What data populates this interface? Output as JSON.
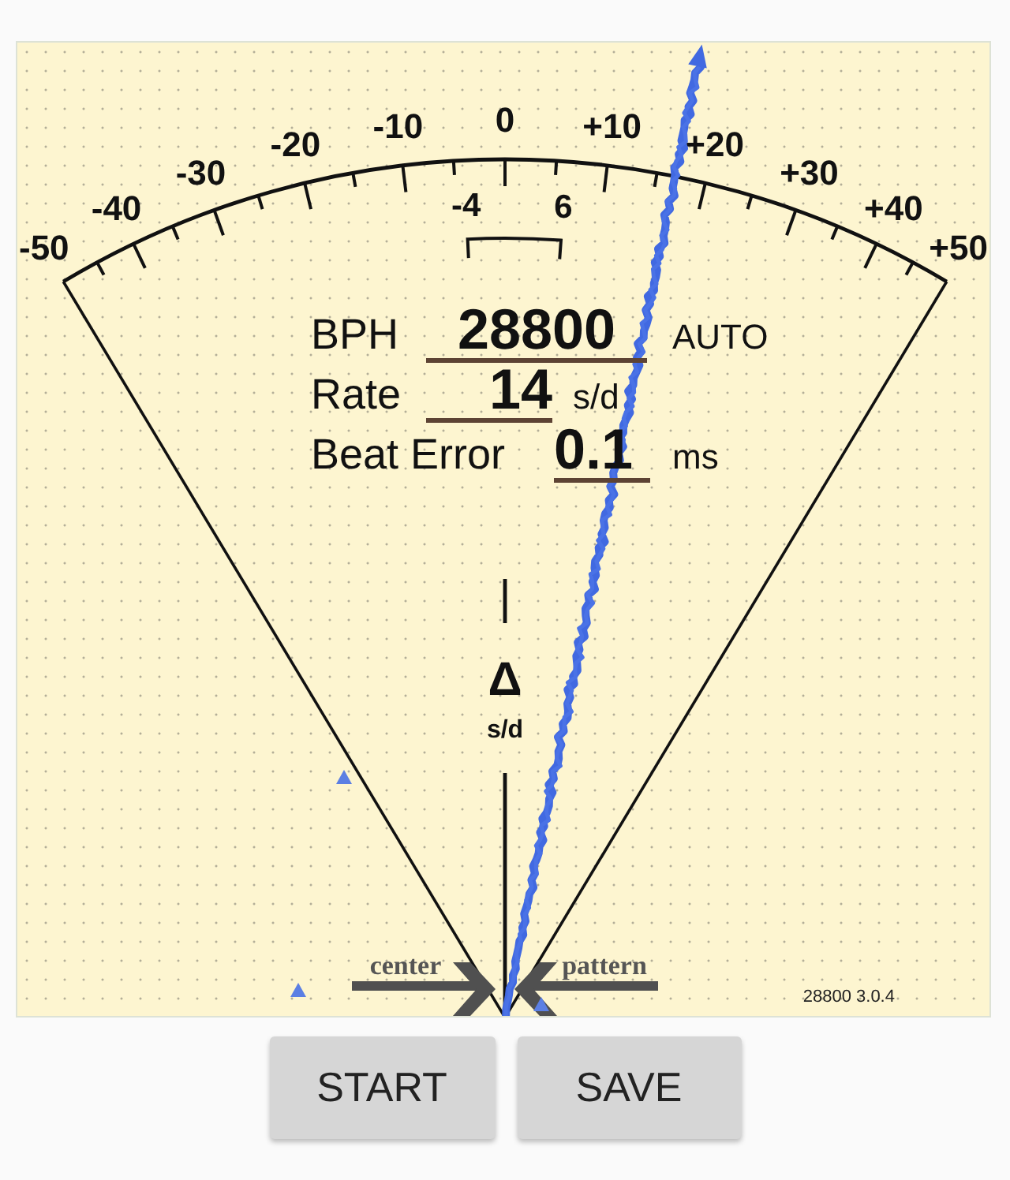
{
  "dial": {
    "scale_labels": [
      "-50",
      "-40",
      "-30",
      "-20",
      "-10",
      "0",
      "+10",
      "+20",
      "+30",
      "+40",
      "+50"
    ],
    "tolerance_labels": [
      "-4",
      "6"
    ],
    "axis": {
      "symbol": "Δ",
      "unit": "s/d"
    },
    "pointers": [
      {
        "label": "center"
      },
      {
        "label": "pattern"
      }
    ],
    "version": "28800 3.0.4"
  },
  "readings": [
    {
      "label": "BPH",
      "value": "28800",
      "suffix": "AUTO"
    },
    {
      "label": "Rate",
      "value": "14",
      "suffix": "s/d"
    },
    {
      "label": "Beat Error",
      "value": "0.1",
      "suffix": "ms"
    }
  ],
  "buttons": [
    {
      "label": "START"
    },
    {
      "label": "SAVE"
    }
  ]
}
